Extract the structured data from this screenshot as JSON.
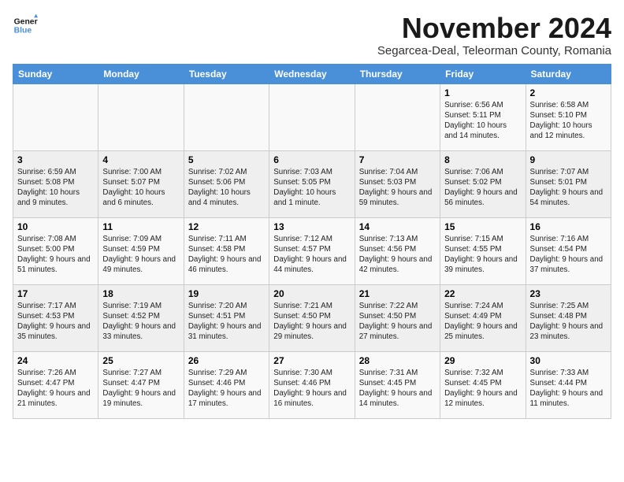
{
  "logo": {
    "line1": "General",
    "line2": "Blue"
  },
  "title": "November 2024",
  "subtitle": "Segarcea-Deal, Teleorman County, Romania",
  "weekdays": [
    "Sunday",
    "Monday",
    "Tuesday",
    "Wednesday",
    "Thursday",
    "Friday",
    "Saturday"
  ],
  "weeks": [
    [
      {
        "day": "",
        "info": ""
      },
      {
        "day": "",
        "info": ""
      },
      {
        "day": "",
        "info": ""
      },
      {
        "day": "",
        "info": ""
      },
      {
        "day": "",
        "info": ""
      },
      {
        "day": "1",
        "info": "Sunrise: 6:56 AM\nSunset: 5:11 PM\nDaylight: 10 hours and 14 minutes."
      },
      {
        "day": "2",
        "info": "Sunrise: 6:58 AM\nSunset: 5:10 PM\nDaylight: 10 hours and 12 minutes."
      }
    ],
    [
      {
        "day": "3",
        "info": "Sunrise: 6:59 AM\nSunset: 5:08 PM\nDaylight: 10 hours and 9 minutes."
      },
      {
        "day": "4",
        "info": "Sunrise: 7:00 AM\nSunset: 5:07 PM\nDaylight: 10 hours and 6 minutes."
      },
      {
        "day": "5",
        "info": "Sunrise: 7:02 AM\nSunset: 5:06 PM\nDaylight: 10 hours and 4 minutes."
      },
      {
        "day": "6",
        "info": "Sunrise: 7:03 AM\nSunset: 5:05 PM\nDaylight: 10 hours and 1 minute."
      },
      {
        "day": "7",
        "info": "Sunrise: 7:04 AM\nSunset: 5:03 PM\nDaylight: 9 hours and 59 minutes."
      },
      {
        "day": "8",
        "info": "Sunrise: 7:06 AM\nSunset: 5:02 PM\nDaylight: 9 hours and 56 minutes."
      },
      {
        "day": "9",
        "info": "Sunrise: 7:07 AM\nSunset: 5:01 PM\nDaylight: 9 hours and 54 minutes."
      }
    ],
    [
      {
        "day": "10",
        "info": "Sunrise: 7:08 AM\nSunset: 5:00 PM\nDaylight: 9 hours and 51 minutes."
      },
      {
        "day": "11",
        "info": "Sunrise: 7:09 AM\nSunset: 4:59 PM\nDaylight: 9 hours and 49 minutes."
      },
      {
        "day": "12",
        "info": "Sunrise: 7:11 AM\nSunset: 4:58 PM\nDaylight: 9 hours and 46 minutes."
      },
      {
        "day": "13",
        "info": "Sunrise: 7:12 AM\nSunset: 4:57 PM\nDaylight: 9 hours and 44 minutes."
      },
      {
        "day": "14",
        "info": "Sunrise: 7:13 AM\nSunset: 4:56 PM\nDaylight: 9 hours and 42 minutes."
      },
      {
        "day": "15",
        "info": "Sunrise: 7:15 AM\nSunset: 4:55 PM\nDaylight: 9 hours and 39 minutes."
      },
      {
        "day": "16",
        "info": "Sunrise: 7:16 AM\nSunset: 4:54 PM\nDaylight: 9 hours and 37 minutes."
      }
    ],
    [
      {
        "day": "17",
        "info": "Sunrise: 7:17 AM\nSunset: 4:53 PM\nDaylight: 9 hours and 35 minutes."
      },
      {
        "day": "18",
        "info": "Sunrise: 7:19 AM\nSunset: 4:52 PM\nDaylight: 9 hours and 33 minutes."
      },
      {
        "day": "19",
        "info": "Sunrise: 7:20 AM\nSunset: 4:51 PM\nDaylight: 9 hours and 31 minutes."
      },
      {
        "day": "20",
        "info": "Sunrise: 7:21 AM\nSunset: 4:50 PM\nDaylight: 9 hours and 29 minutes."
      },
      {
        "day": "21",
        "info": "Sunrise: 7:22 AM\nSunset: 4:50 PM\nDaylight: 9 hours and 27 minutes."
      },
      {
        "day": "22",
        "info": "Sunrise: 7:24 AM\nSunset: 4:49 PM\nDaylight: 9 hours and 25 minutes."
      },
      {
        "day": "23",
        "info": "Sunrise: 7:25 AM\nSunset: 4:48 PM\nDaylight: 9 hours and 23 minutes."
      }
    ],
    [
      {
        "day": "24",
        "info": "Sunrise: 7:26 AM\nSunset: 4:47 PM\nDaylight: 9 hours and 21 minutes."
      },
      {
        "day": "25",
        "info": "Sunrise: 7:27 AM\nSunset: 4:47 PM\nDaylight: 9 hours and 19 minutes."
      },
      {
        "day": "26",
        "info": "Sunrise: 7:29 AM\nSunset: 4:46 PM\nDaylight: 9 hours and 17 minutes."
      },
      {
        "day": "27",
        "info": "Sunrise: 7:30 AM\nSunset: 4:46 PM\nDaylight: 9 hours and 16 minutes."
      },
      {
        "day": "28",
        "info": "Sunrise: 7:31 AM\nSunset: 4:45 PM\nDaylight: 9 hours and 14 minutes."
      },
      {
        "day": "29",
        "info": "Sunrise: 7:32 AM\nSunset: 4:45 PM\nDaylight: 9 hours and 12 minutes."
      },
      {
        "day": "30",
        "info": "Sunrise: 7:33 AM\nSunset: 4:44 PM\nDaylight: 9 hours and 11 minutes."
      }
    ]
  ]
}
